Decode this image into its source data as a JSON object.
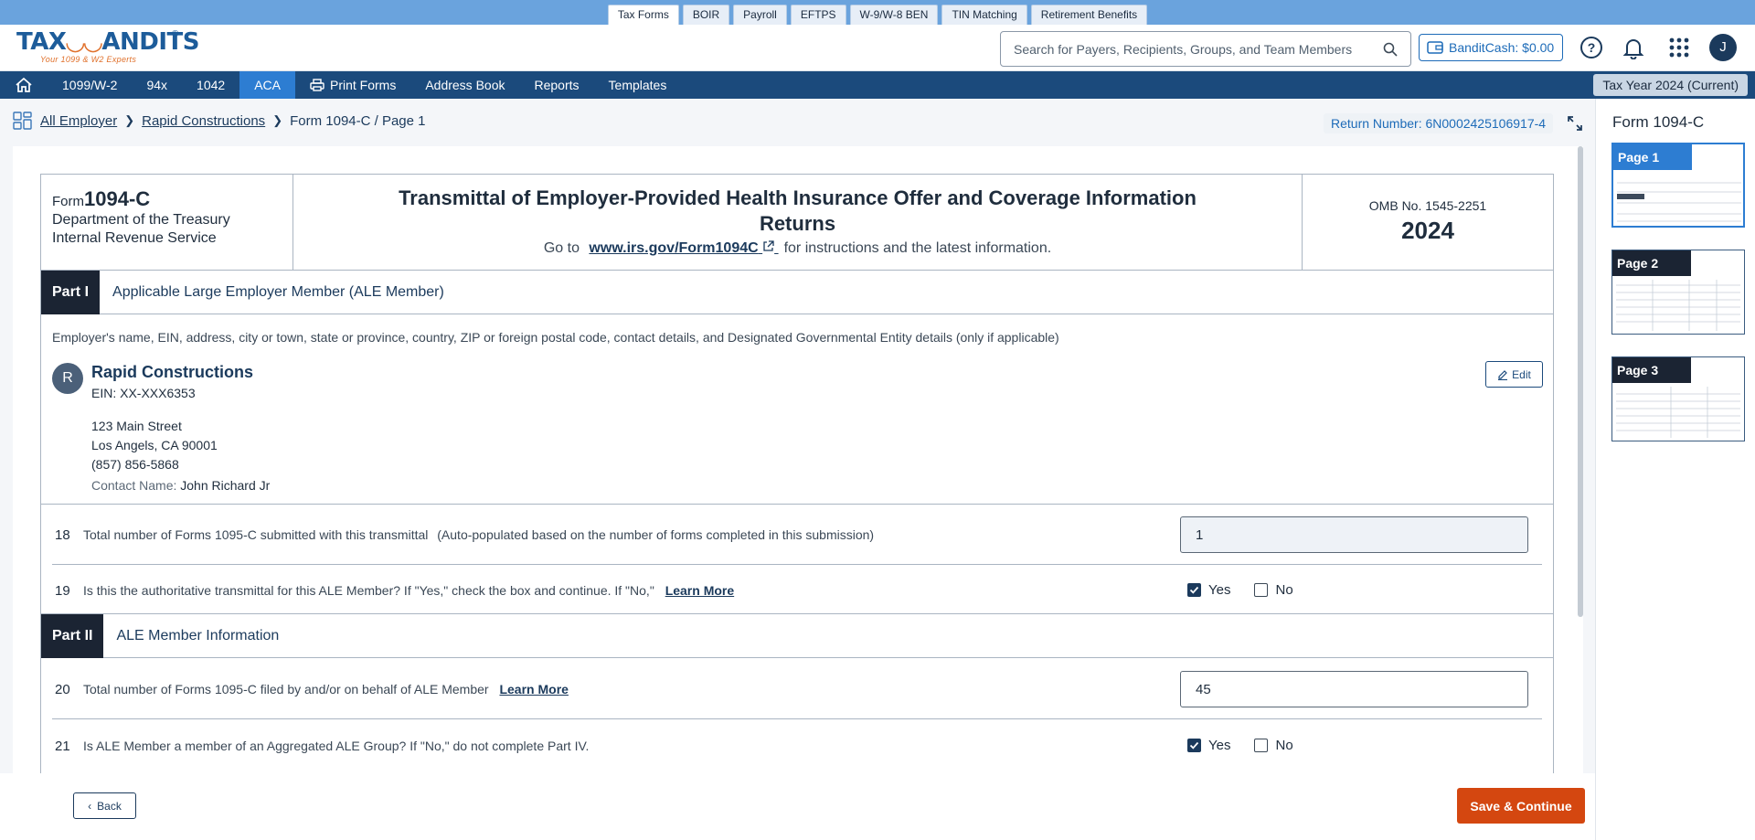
{
  "product_tabs": [
    "Tax Forms",
    "BOIR",
    "Payroll",
    "EFTPS",
    "W-9/W-8 BEN",
    "TIN Matching",
    "Retirement Benefits"
  ],
  "logo": {
    "text_a": "TAX",
    "text_owl": "",
    "text_b": "ANDITS",
    "reg": "®",
    "tagline": "Your 1099 & W2 Experts"
  },
  "header": {
    "search_placeholder": "Search for Payers, Recipients, Groups, and Team Members",
    "bandit_cash": "BanditCash: $0.00",
    "avatar_initial": "J"
  },
  "nav": {
    "items": [
      "1099/W-2",
      "94x",
      "1042",
      "ACA",
      "Print Forms",
      "Address Book",
      "Reports",
      "Templates"
    ],
    "active": "ACA",
    "tax_year": "Tax Year 2024 (Current)"
  },
  "breadcrumb": {
    "all_employer": "All Employer",
    "employer": "Rapid Constructions",
    "current": "Form 1094-C / Page 1",
    "return_number": "Return Number: 6N0002425106917-4"
  },
  "form": {
    "form_prefix": "Form",
    "form_name": "1094-C",
    "dept_line1": "Department of the Treasury",
    "dept_line2": "Internal Revenue Service",
    "title": "Transmittal of Employer-Provided Health Insurance Offer and Coverage Information Returns",
    "goto_prefix": "Go to",
    "goto_link": "www.irs.gov/Form1094C",
    "goto_suffix": "for instructions and the latest information.",
    "omb": "OMB No. 1545-2251",
    "year": "2024"
  },
  "part1": {
    "label": "Part I",
    "title": "Applicable Large Employer Member (ALE Member)",
    "description": "Employer's name, EIN, address, city or town, state or province, country, ZIP or foreign postal code, contact details, and Designated Governmental Entity details (only if applicable)",
    "employer": {
      "initial": "R",
      "name": "Rapid Constructions",
      "ein": "EIN: XX-XXX6353",
      "address1": "123 Main Street",
      "address2": "Los Angels, CA 90001",
      "phone": "(857) 856-5868",
      "contact_label": "Contact Name:",
      "contact_name": "John Richard Jr"
    },
    "edit_label": "Edit",
    "line18": {
      "num": "18",
      "text": "Total number of Forms 1095-C submitted with this transmittal",
      "hint": "(Auto-populated based on the number of forms completed in this submission)",
      "value": "1"
    },
    "line19": {
      "num": "19",
      "text": "Is this the authoritative transmittal for this ALE Member? If \"Yes,\" check the box and continue. If \"No,\"",
      "link": "Learn More",
      "yes": "Yes",
      "no": "No",
      "selected": "Yes"
    }
  },
  "part2": {
    "label": "Part II",
    "title": "ALE Member Information",
    "line20": {
      "num": "20",
      "text": "Total number of Forms 1095-C filed by and/or on behalf of ALE Member",
      "link": "Learn More",
      "value": "45"
    },
    "line21": {
      "num": "21",
      "text": "Is ALE Member a member of an Aggregated ALE Group? If \"No,\" do not complete Part IV.",
      "yes": "Yes",
      "no": "No",
      "selected": "Yes"
    }
  },
  "footer": {
    "back": "Back",
    "save": "Save & Continue"
  },
  "sidebar": {
    "title": "Form 1094-C",
    "pages": [
      "Page 1",
      "Page 2",
      "Page 3"
    ],
    "active_page": "Page 1"
  }
}
